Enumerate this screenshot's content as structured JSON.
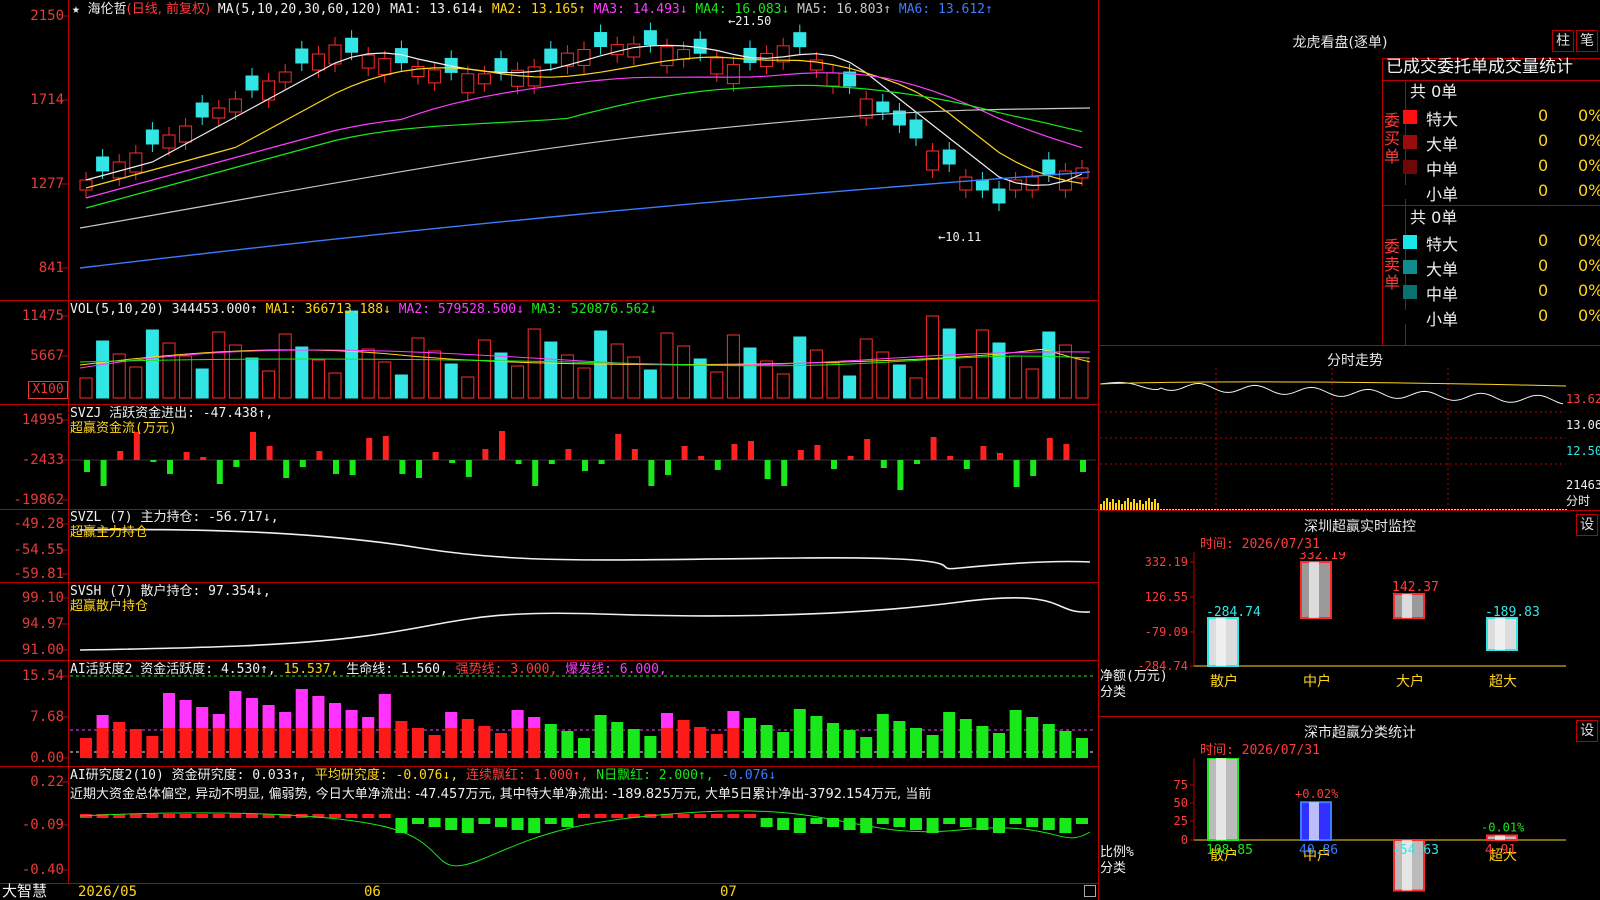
{
  "header": {
    "stock_name": "海伦哲",
    "period": "(日线, 前复权)",
    "ma_prefix": "MA(5,10,20,30,60,120)",
    "ma": [
      {
        "label": "MA1: 13.614↓",
        "color": "#f0f0f0"
      },
      {
        "label": "MA2: 13.165↑",
        "color": "#ffd51a"
      },
      {
        "label": "MA3: 14.493↓",
        "color": "#ff3cff"
      },
      {
        "label": "MA4: 16.083↓",
        "color": "#19e81a"
      },
      {
        "label": "MA5: 16.803↑",
        "color": "#c8c8c8"
      },
      {
        "label": "MA6: 13.612↑",
        "color": "#3c7cff"
      }
    ],
    "high_label": "21.50",
    "low_label": "10.11"
  },
  "price_axis": [
    "2150",
    "1714",
    "1277",
    "841"
  ],
  "vol": {
    "title": "VOL(5,10,20)",
    "value": "344453.000↑",
    "ma1": "MA1: 366713.188↓",
    "ma2": "MA2: 579528.500↓",
    "ma3": "MA3: 520876.562↓",
    "axis": [
      "11475",
      "5667"
    ],
    "unit": "X100"
  },
  "svzj": {
    "title": "SVZJ  活跃资金进出: -47.438↑,",
    "subtitle": "超赢资金流(万元)",
    "axis": [
      "14995",
      "-2433",
      "-19862"
    ]
  },
  "svzl": {
    "title": "SVZL (7) 主力持仓: -56.717↓,",
    "subtitle": "超赢主力持仓",
    "axis": [
      "-49.28",
      "-54.55",
      "-59.81"
    ]
  },
  "svsh": {
    "title": "SVSH (7) 散户持仓: 97.354↓,",
    "subtitle": "超赢散户持仓",
    "axis": [
      "99.10",
      "94.97",
      "91.00"
    ]
  },
  "ai_active": {
    "title": "AI活跃度2 资金活跃度: 4.530↑,",
    "v1": "15.537,",
    "v2": "生命线: 1.560,",
    "v3": "强势线: 3.000,",
    "v4": "爆发线: 6.000,",
    "axis": [
      "15.54",
      "7.68",
      "0.00"
    ]
  },
  "ai_research": {
    "title": "AI研究度2(10) 资金研究度: 0.033↑,",
    "v1": "平均研究度: -0.076↓,",
    "v2": "连续飘红: 1.000↑,",
    "v3": "N日飘红: 2.000↑,",
    "v4": "-0.076↓",
    "comment": "近期大资金总体偏空, 异动不明显, 偏弱势, 今日大单净流出: -47.457万元, 其中特大单净流出: -189.825万元, 大单5日累计净出-3792.154万元, 当前",
    "axis": [
      "0.22",
      "-0.09",
      "-0.40"
    ]
  },
  "bottom_bar": {
    "brand": "大智慧",
    "dates": [
      "2026/05",
      "06",
      "07"
    ]
  },
  "right_panel": {
    "lhb_title": "龙虎看盘(逐单)",
    "btn_bar": "柱",
    "btn_pen": "笔",
    "stat_title": "已成交委托单成交量统计",
    "buy": {
      "label": "委买单",
      "total": "共 0单",
      "rows": [
        {
          "label": "特大",
          "count": "0",
          "pct": "0%",
          "color": "#ff1010"
        },
        {
          "label": "大单",
          "count": "0",
          "pct": "0%",
          "color": "#9a0c0c"
        },
        {
          "label": "中单",
          "count": "0",
          "pct": "0%",
          "color": "#6e0808"
        },
        {
          "label": "小单",
          "count": "0",
          "pct": "0%",
          "color": "#000000"
        }
      ]
    },
    "sell": {
      "label": "委卖单",
      "total": "共 0单",
      "rows": [
        {
          "label": "特大",
          "count": "0",
          "pct": "0%",
          "color": "#19e6e6"
        },
        {
          "label": "大单",
          "count": "0",
          "pct": "0%",
          "color": "#108c8c"
        },
        {
          "label": "中单",
          "count": "0",
          "pct": "0%",
          "color": "#0c7070"
        },
        {
          "label": "小单",
          "count": "0",
          "pct": "0%",
          "color": "#000000"
        }
      ]
    },
    "intraday": {
      "title": "分时走势",
      "axis": [
        "13.62",
        "13.06",
        "12.50",
        "21463"
      ],
      "axis_unit": "分时"
    },
    "monitor": {
      "title": "深圳超赢实时监控",
      "btn": "设",
      "time": "时间: 2026/07/31",
      "axis": [
        "332.19",
        "126.55",
        "-79.09",
        "-284.74"
      ],
      "ylabel": "净额(万元)",
      "xlabel": "分类"
    },
    "classify": {
      "title": "深市超赢分类统计",
      "btn": "设",
      "time": "时间: 2026/07/31",
      "axis": [
        "75",
        "50",
        "25",
        "0"
      ],
      "ylabel": "比例%",
      "xlabel": "分类"
    }
  },
  "chart_data": [
    {
      "type": "bar",
      "title": "深圳超赢实时监控",
      "ylabel": "净额(万元)",
      "xlabel": "分类",
      "categories": [
        "散户",
        "中户",
        "大户",
        "超大"
      ],
      "values": [
        -284.74,
        332.19,
        142.37,
        -189.83
      ],
      "ylim": [
        -284.74,
        332.19
      ]
    },
    {
      "type": "bar",
      "title": "深市超赢分类统计",
      "ylabel": "比例%",
      "xlabel": "分类",
      "categories": [
        "散户",
        "中户",
        "大户",
        "超大"
      ],
      "values": [
        108.85,
        40.86,
        -54.63,
        4.91
      ],
      "annotations": [
        "",
        "+0.02%",
        "",
        "-0.01%"
      ],
      "ylim": [
        0,
        75
      ]
    }
  ]
}
